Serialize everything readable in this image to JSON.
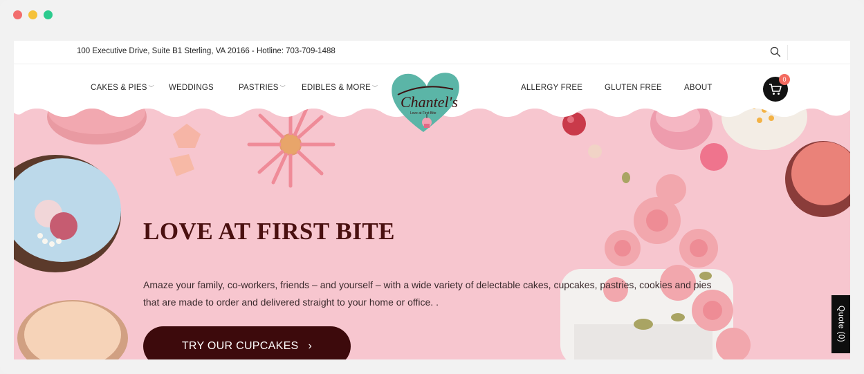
{
  "window": {
    "controls": [
      "close",
      "minimize",
      "maximize"
    ]
  },
  "topbar": {
    "address": "100 Executive Drive, Suite B1 Sterling, VA 20166 - Hotline: 703-709-1488",
    "search_icon": "search-icon"
  },
  "nav": {
    "items": [
      {
        "label": "CAKES & PIES",
        "dropdown": true
      },
      {
        "label": "WEDDINGS",
        "dropdown": false
      },
      {
        "label": "PASTRIES",
        "dropdown": true
      },
      {
        "label": "EDIBLES & MORE",
        "dropdown": true
      },
      {
        "label": "ALLERGY FREE",
        "dropdown": false
      },
      {
        "label": "GLUTEN FREE",
        "dropdown": false
      },
      {
        "label": "ABOUT",
        "dropdown": false
      }
    ],
    "logo_text": "Chantel's",
    "logo_tagline": "Love at First Bite",
    "cart_count": "0",
    "cart_icon": "cart-icon"
  },
  "hero": {
    "title": "LOVE AT FIRST BITE",
    "description": "Amaze your family, co-workers, friends – and yourself – with a wide variety of delectable cakes, cupcakes, pastries, cookies and pies that are made to order and delivered straight to your home or office. .",
    "cta_label": "TRY OUR CUPCAKES",
    "cta_arrow": "›"
  },
  "quote_tab": {
    "label": "Quote (0)"
  },
  "colors": {
    "hero_bg": "#f7c7d0",
    "title": "#4a1010",
    "cta_bg": "#3d0a0c",
    "badge": "#f36a5f",
    "logo_heart": "#5bb5a7"
  }
}
